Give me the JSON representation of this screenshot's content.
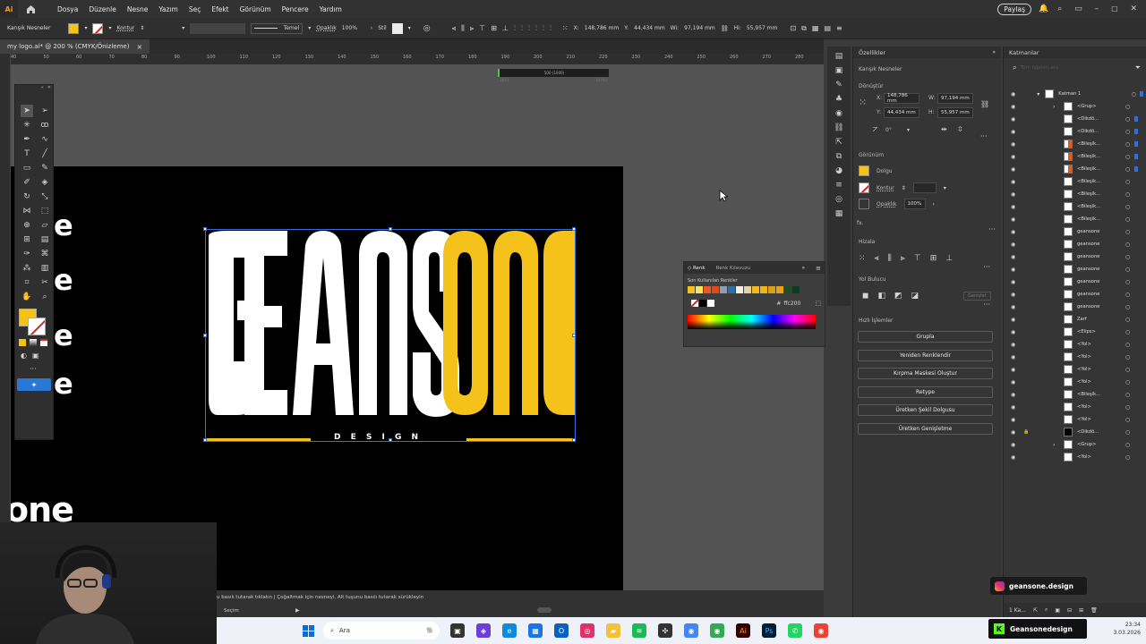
{
  "app": {
    "logo": "Ai",
    "home_icon": "home-icon"
  },
  "menu": [
    "Dosya",
    "Düzenle",
    "Nesne",
    "Yazım",
    "Seç",
    "Efekt",
    "Görünüm",
    "Pencere",
    "Yardım"
  ],
  "share_label": "Paylaş",
  "control": {
    "object_type": "Karışık Nesneler",
    "stroke_label": "Kontur",
    "stroke_style": "Temel",
    "opacity_label": "Opaklık",
    "opacity_value": "100%",
    "style_label": "Stil",
    "x_label": "X:",
    "x_value": "148,786 mm",
    "y_label": "Y:",
    "y_value": "44,434 mm",
    "w_label": "Wi:",
    "w_value": "97,194 mm",
    "h_label": "Hi:",
    "h_value": "55,957 mm"
  },
  "document_tab": {
    "title": "my logo.ai* @ 200 % (CMYK/Önizleme)",
    "close": "×"
  },
  "ruler_ticks": [
    "40",
    "50",
    "60",
    "70",
    "80",
    "90",
    "100",
    "110",
    "120",
    "130",
    "140",
    "150",
    "160",
    "170",
    "180",
    "190",
    "200",
    "210",
    "220",
    "230",
    "240",
    "250",
    "260",
    "270",
    "280"
  ],
  "mini_ruler": {
    "label": "500 (1000)",
    "left": "1KY0",
    "right": "1KY00"
  },
  "artwork": {
    "word_white": "GEANS",
    "word_yellow": "ONE",
    "tagline": "D E S I G N",
    "partial_letters": [
      "e",
      "e",
      "e",
      "e"
    ],
    "bottom_partial": "one",
    "colors": {
      "canvas": "#000000",
      "white": "#ffffff",
      "yellow": "#f5c21b"
    }
  },
  "status": {
    "hint": "u basılı tutarak tıklatın | Çoğaltmak için nesneyi, Alt tuşunu basılı tutarak sürükleyin",
    "mode": "Seçim"
  },
  "color_panel": {
    "tab_color": "Renk",
    "tab_guide": "Renk Kılavuzu",
    "recent_label": "Son Kullanılan Renkler",
    "hex_label": "#",
    "hex_value": "ffc200",
    "recent_swatches": [
      "#f5c21b",
      "#f7e36a",
      "#f05a22",
      "#e24a1a",
      "#8aa0b8",
      "#2e6fa8",
      "#f3efe0",
      "#e7d3a2",
      "#f0b81a",
      "#f4b31a",
      "#d9a11a",
      "#e8a21a",
      "#1e4d2b",
      "#0d3b1f"
    ]
  },
  "properties": {
    "title": "Özellikler",
    "object_type": "Karışık Nesneler",
    "transform_title": "Dönüştür",
    "x_label": "X:",
    "x_value": "148,786 mm",
    "y_label": "Y:",
    "y_value": "44,434 mm",
    "w_label": "W:",
    "w_value": "97,194 mm",
    "h_label": "H:",
    "h_value": "55,957 mm",
    "angle_value": "0°",
    "appearance_title": "Görünüm",
    "fill_label": "Dolgu",
    "stroke_label": "Kontur",
    "opacity_label": "Opaklık",
    "opacity_value": "100%",
    "fx_label": "fx.",
    "align_title": "Hizala",
    "pathfinder_title": "Yol Bulucu",
    "pathfinder_more": "Genişlet",
    "quick_title": "Hızlı İşlemler",
    "quick_actions": [
      "Grupla",
      "Yeniden Renklendir",
      "Kırpma Maskesi Oluştur",
      "Retype",
      "Üretken Şekil Dolgusu",
      "Üretken Genişletme"
    ],
    "fill_color": "#f5c21b"
  },
  "layers": {
    "title": "Katmanlar",
    "search_placeholder": "Tüm öğeleri ara",
    "layer_name": "Katman 1",
    "items": [
      "<Grup>",
      "<Dikdö...",
      "<Dikdö...",
      "<Bileşik...",
      "<Bileşik...",
      "<Bileşik...",
      "<Bileşik...",
      "<Bileşik...",
      "<Bileşik...",
      "<Bileşik...",
      "geansone",
      "geansone",
      "geansone",
      "geansone",
      "geansone",
      "geansone",
      "geansone",
      "Zarf",
      "<Elips>",
      "<Yol>",
      "<Yol>",
      "<Yol>",
      "<Yol>",
      "<Bileşik...",
      "<Yol>",
      "<Yol>",
      "<Dikdö...",
      "<Grup>",
      "<Yol>"
    ],
    "footer_label": "1 Ka..."
  },
  "overlay_badge": {
    "handle": "geansone.design"
  },
  "taskbar": {
    "search_label": "Ara",
    "badge": "Geansonedesign",
    "time": "23:34",
    "date": "3.03.2026"
  }
}
